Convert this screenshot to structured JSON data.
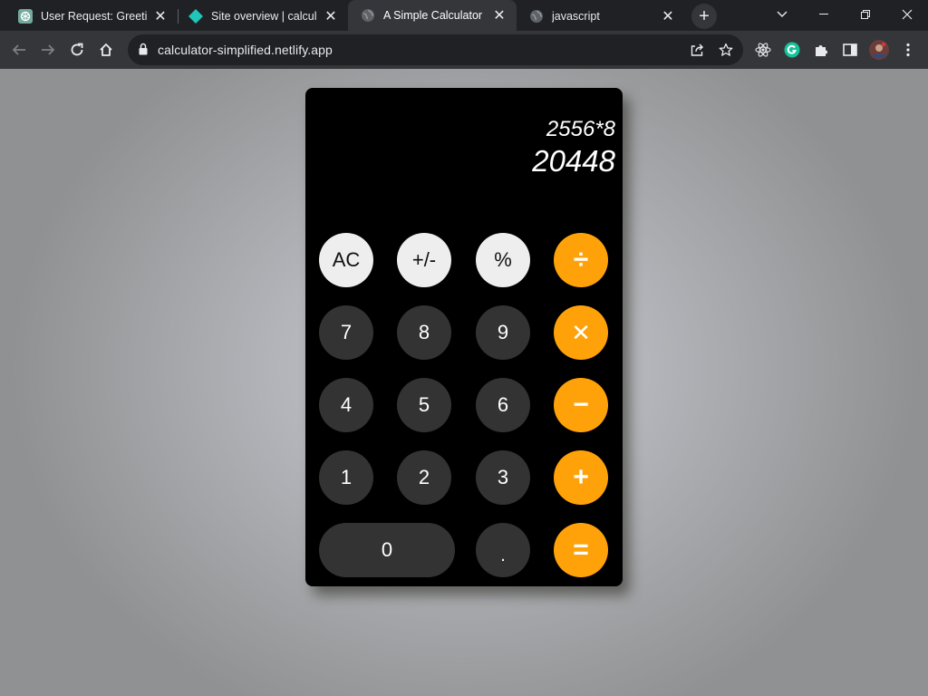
{
  "browser": {
    "tabs": [
      {
        "title": "User Request: Greeting",
        "favicon": "chatgpt-icon",
        "active": false
      },
      {
        "title": "Site overview | calculator",
        "favicon": "netlify-icon",
        "active": false
      },
      {
        "title": "A Simple Calculator",
        "favicon": "globe-icon",
        "active": true
      },
      {
        "title": "javascript",
        "favicon": "globe-icon",
        "active": false
      }
    ],
    "close_glyph": "✕",
    "new_tab_glyph": "+",
    "url": "calculator-simplified.netlify.app"
  },
  "calculator": {
    "expression": "2556*8",
    "result": "20448",
    "keys": {
      "ac": "AC",
      "sign": "+/-",
      "percent": "%",
      "divide": "÷",
      "seven": "7",
      "eight": "8",
      "nine": "9",
      "multiply": "✕",
      "four": "4",
      "five": "5",
      "six": "6",
      "subtract": "−",
      "one": "1",
      "two": "2",
      "three": "3",
      "add": "+",
      "zero": "0",
      "decimal": ".",
      "equals": "="
    }
  },
  "colors": {
    "operator": "#ffa20a",
    "digit": "#333333",
    "function": "#eeeeee",
    "calculator_bg": "#000000"
  }
}
